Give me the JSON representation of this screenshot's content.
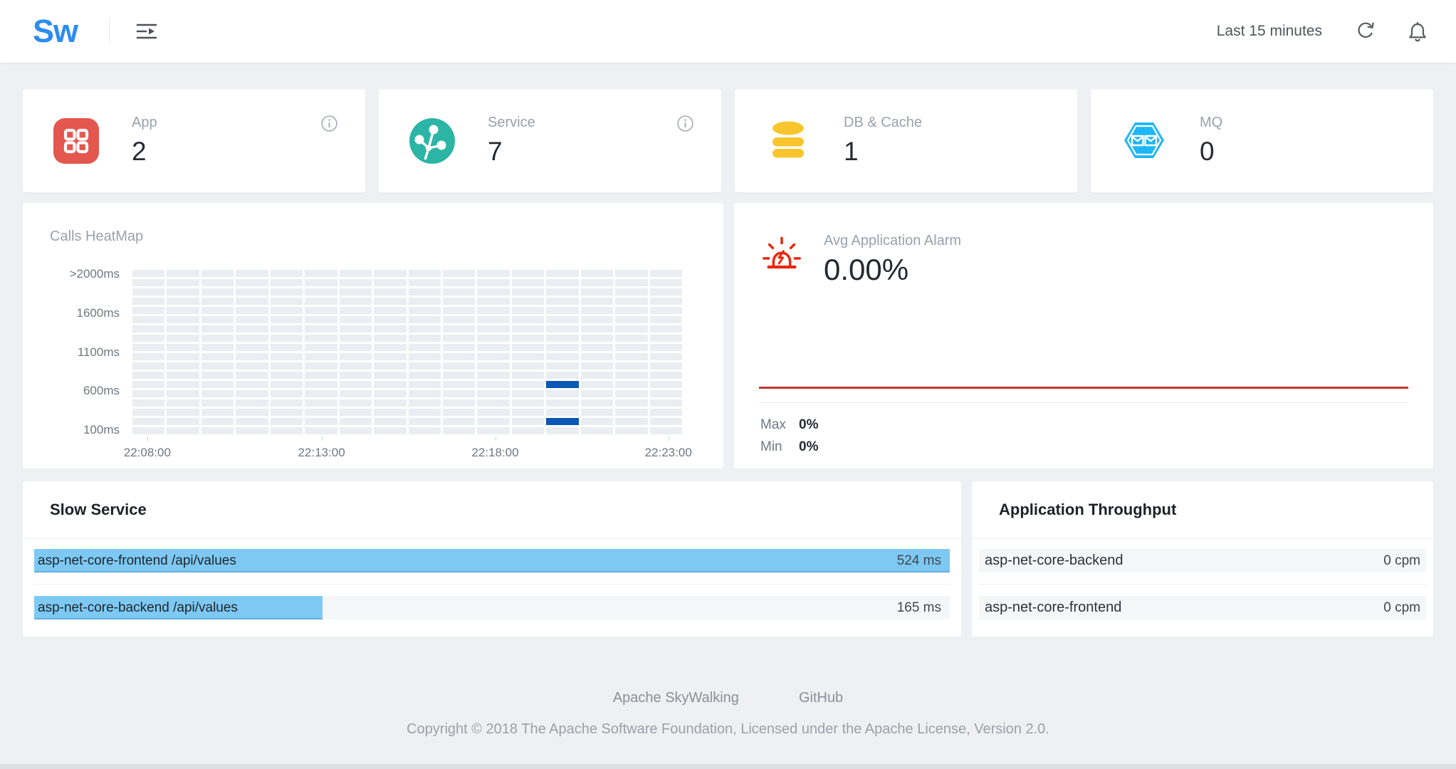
{
  "header": {
    "logo_text": "Sw",
    "time_range": "Last 15 minutes"
  },
  "stat_cards": [
    {
      "label": "App",
      "value": "2",
      "icon": "app-grid",
      "color": "#e4574e",
      "has_info": true
    },
    {
      "label": "Service",
      "value": "7",
      "icon": "service-network",
      "color": "#2cb5a5",
      "has_info": true
    },
    {
      "label": "DB & Cache",
      "value": "1",
      "icon": "database",
      "color": "#f8c62c",
      "has_info": false
    },
    {
      "label": "MQ",
      "value": "0",
      "icon": "mq-hexagon",
      "color": "#1fb6f5",
      "has_info": false
    }
  ],
  "heatmap": {
    "title": "Calls HeatMap",
    "y_labels": [
      ">2000ms",
      "1600ms",
      "1100ms",
      "600ms",
      "100ms"
    ],
    "x_labels": [
      "22:08:00",
      "22:13:00",
      "22:18:00",
      "22:23:00"
    ],
    "x_tick_fractions": [
      0.027,
      0.344,
      0.66,
      0.975
    ],
    "rows": 18,
    "cols": 16,
    "cell_color": "#eaedf1",
    "active_color": "#0b57b6",
    "active_cells": [
      {
        "row": 12,
        "col": 12
      },
      {
        "row": 16,
        "col": 12
      }
    ]
  },
  "alarm": {
    "title": "Avg Application Alarm",
    "value": "0.00%",
    "line_color": "#c23531",
    "stats": [
      {
        "label": "Max",
        "value": "0%"
      },
      {
        "label": "Min",
        "value": "0%"
      }
    ]
  },
  "slow_service": {
    "title": "Slow Service",
    "bar_color": "#7dc9f3",
    "items": [
      {
        "name": "asp-net-core-frontend /api/values",
        "value": "524 ms",
        "percent": 100
      },
      {
        "name": "asp-net-core-backend /api/values",
        "value": "165 ms",
        "percent": 31.5
      }
    ]
  },
  "throughput": {
    "title": "Application Throughput",
    "items": [
      {
        "name": "asp-net-core-backend",
        "value": "0 cpm",
        "percent": 0
      },
      {
        "name": "asp-net-core-frontend",
        "value": "0 cpm",
        "percent": 0
      }
    ]
  },
  "footer": {
    "links": [
      "Apache SkyWalking",
      "GitHub"
    ],
    "copyright": "Copyright © 2018 The Apache Software Foundation, Licensed under the Apache License, Version 2.0."
  }
}
